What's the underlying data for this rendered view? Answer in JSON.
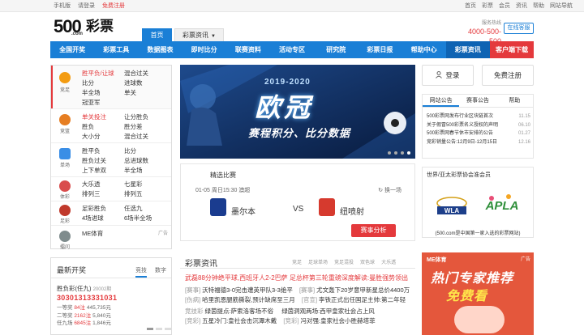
{
  "topbar": {
    "mobile": "手机版",
    "login": "请登录",
    "register": "免费注册",
    "right_links": [
      "首页",
      "彩票",
      "会员",
      "资讯",
      "帮助",
      "网站导航"
    ]
  },
  "header": {
    "logo_num": "500",
    "logo_com": ".com",
    "logo_cp": "彩票",
    "tabs": [
      {
        "label": "首页"
      },
      {
        "label": "彩票资讯"
      }
    ],
    "hotline_title": "服务热线",
    "hotline": "4000-500-500",
    "kefu": "在线客服"
  },
  "mainnav": [
    "全国开奖",
    "彩票工具",
    "数据图表",
    "即时比分",
    "联赛资料",
    "活动专区",
    "研究院",
    "彩票日报",
    "帮助中心",
    "彩票资讯",
    "客户端下载"
  ],
  "categories": [
    {
      "name": "竞足",
      "items": [
        "胜平负/让球",
        "混合过关",
        "比分",
        "进球数",
        "半全场",
        "单关",
        "冠亚军",
        ""
      ]
    },
    {
      "name": "竞篮",
      "items": [
        "单关投注",
        "让分胜负",
        "胜负",
        "胜分差",
        "大小分",
        "混合过关"
      ]
    },
    {
      "name": "单场",
      "items": [
        "胜平负",
        "比分",
        "胜负过关",
        "总进球数",
        "上下单双",
        "半全场"
      ]
    },
    {
      "name": "体彩",
      "items": [
        "大乐透",
        "七星彩",
        "排列三",
        "排列五"
      ]
    },
    {
      "name": "足彩",
      "items": [
        "足彩胜负",
        "任选九",
        "4场进球",
        "6场半全场"
      ]
    },
    {
      "name": "擂问",
      "items": [
        "ME体育"
      ],
      "ad": "广告"
    }
  ],
  "banner": {
    "year": "2019-2020",
    "title": "欧冠",
    "sub": "赛程积分、比分数据"
  },
  "match": {
    "header": "精选比赛",
    "info": "01-05 周日15:30 澳超",
    "swap": "换一场",
    "home": "墨尔本",
    "vs": "VS",
    "away": "纽喷射",
    "button": "赛事分析",
    "colors": {
      "home_crest": "#1a3c8f",
      "away_crest": "#d63a2e"
    }
  },
  "news": {
    "header": "彩票资讯",
    "tags": [
      "竞足",
      "足球单场",
      "竞足混投",
      "双色球",
      "大乐透"
    ],
    "headline": "武磊88分钟绝平球,西班牙人2-2巴萨   足总杯第三轮重磅深度解读:曼胜强势领出",
    "rows": [
      {
        "cat": "[赛事]",
        "text": "沃特福德3-0完击遭英甲队3-3绝平",
        "cat2": "[赛事]",
        "text2": "尤文轰下20岁意甲新星总价4400万"
      },
      {
        "cat": "[伤病]",
        "text": "哈里凯恩腿筋撕裂,预计缺席至三月",
        "cat2": "[官宣]",
        "text2": "李铁正式出任国足主帅:第二年轻"
      },
      {
        "cat": "竞技彩",
        "text": "绿茵提点:萨索洛客场不俗",
        "cat2": "",
        "text2": "绿茵洞观两场:西甲皇家社会占上风",
        "gap": true
      },
      {
        "cat": "[竞彩]",
        "text": "五星冷门:皇社会击沉潭木戴",
        "cat2": "[竞彩]",
        "text2": "冯对强:皇家社会小胜赫塔菲"
      }
    ]
  },
  "latest": {
    "header": "最新开奖",
    "tabs": [
      "竞技",
      "数字"
    ],
    "lottery_name": "胜负彩(任九)",
    "issue": "20002期",
    "numbers": "30301313331031",
    "prizes": [
      {
        "label": "一等奖 ",
        "count": "84注",
        "amount": " 445,735元"
      },
      {
        "label": "二等奖 ",
        "count": "2162注",
        "amount": " 5,840元"
      },
      {
        "label": "任九场 ",
        "count": "6845注",
        "amount": " 1,846元"
      }
    ]
  },
  "right": {
    "login": "登录",
    "register": "免费注册",
    "notice_tabs": [
      "网站公告",
      "赛事公告",
      "帮助"
    ],
    "notices": [
      {
        "text": "500彩票网发布行业区块链首次",
        "date": "11.15"
      },
      {
        "text": "关于假冒500彩票名义授权的声明",
        "date": "06.10"
      },
      {
        "text": "500彩票网春节休市安排的公告",
        "date": "01.27"
      },
      {
        "text": "竞彩销量公告:12月9日-12月15日",
        "date": "12.16"
      }
    ],
    "members_header": "世界/亚太彩票协会准会员",
    "wla_text": "WLA",
    "apla_text": "APLA",
    "members_footer": "(500.com是中国第一家入选的彩票网站)",
    "ad_brand": "ME体育",
    "ad_tag": "广告",
    "ad_line1": "热门专家推荐",
    "ad_line2": "免费看"
  }
}
